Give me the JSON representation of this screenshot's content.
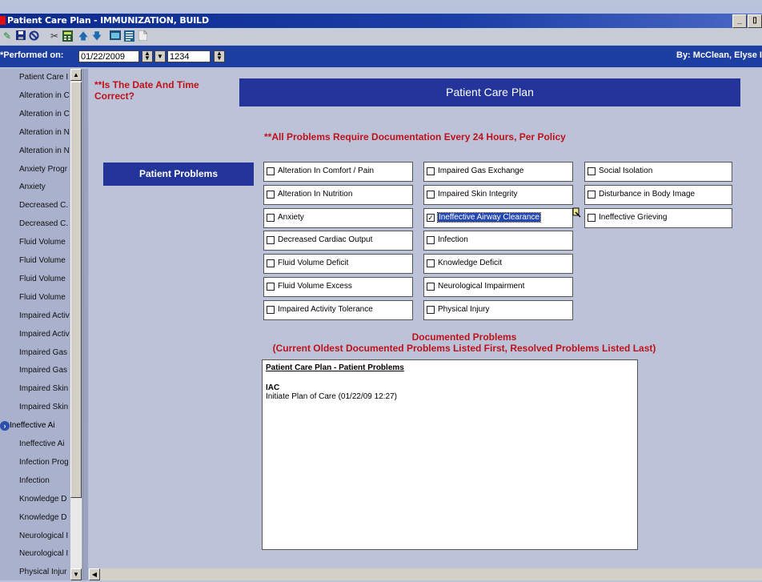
{
  "window": {
    "title": "Patient Care Plan - IMMUNIZATION, BUILD",
    "buttons": [
      "_",
      "▯"
    ]
  },
  "toolbar": {
    "icons": [
      "pencil-icon",
      "save-icon",
      "cancel-icon",
      "scissors-icon",
      "calculator-icon",
      "up-arrow-icon",
      "down-arrow-icon",
      "calendar-icon",
      "form-icon",
      "document-icon"
    ]
  },
  "performed": {
    "label": "*Performed on:",
    "date": "01/22/2009",
    "time": "1234",
    "by": "By:  McClean, Elyse  I"
  },
  "sidebar": {
    "items": [
      "Patient Care I",
      "Alteration in C",
      "Alteration in C",
      "Alteration in N",
      "Alteration in N",
      "Anxiety Progr",
      "Anxiety",
      "Decreased C.",
      "Decreased C.",
      "Fluid Volume",
      "Fluid Volume",
      "Fluid Volume",
      "Fluid Volume",
      "Impaired Activ",
      "Impaired Activ",
      "Impaired Gas",
      "Impaired Gas",
      "Impaired Skin",
      "Impaired Skin",
      "Ineffective Ai",
      "Ineffective Ai",
      "Infection Prog",
      "Infection",
      "Knowledge D",
      "Knowledge D",
      "Neurological I",
      "Neurological I",
      "Physical Injur"
    ],
    "selected_index": 19
  },
  "main": {
    "date_check": "**Is The Date And Time Correct?",
    "banner": "Patient Care Plan",
    "policy": "**All Problems Require Documentation Every 24 Hours, Per Policy",
    "problems_label": "Patient Problems",
    "col1": [
      {
        "label": "Alteration In Comfort / Pain",
        "checked": false
      },
      {
        "label": "Alteration In Nutrition",
        "checked": false
      },
      {
        "label": "Anxiety",
        "checked": false
      },
      {
        "label": "Decreased Cardiac Output",
        "checked": false
      },
      {
        "label": "Fluid Volume Deficit",
        "checked": false
      },
      {
        "label": "Fluid Volume Excess",
        "checked": false
      },
      {
        "label": "Impaired Activity Tolerance",
        "checked": false
      }
    ],
    "col2": [
      {
        "label": "Impaired Gas Exchange",
        "checked": false
      },
      {
        "label": "Impaired Skin Integrity",
        "checked": false
      },
      {
        "label": "Ineffective Airway Clearance",
        "checked": true
      },
      {
        "label": "Infection",
        "checked": false
      },
      {
        "label": "Knowledge Deficit",
        "checked": false
      },
      {
        "label": "Neurological Impairment",
        "checked": false
      },
      {
        "label": "Physical Injury",
        "checked": false
      }
    ],
    "col3": [
      {
        "label": "Social Isolation",
        "checked": false
      },
      {
        "label": "Disturbance in Body Image",
        "checked": false
      },
      {
        "label": "Ineffective Grieving",
        "checked": false
      }
    ],
    "documented_title": "Documented Problems",
    "documented_sub": "(Current Oldest Documented Problems Listed First, Resolved Problems Listed Last)",
    "doc": {
      "heading": "Patient Care Plan - Patient Problems",
      "section": "IAC",
      "line": "Initiate Plan of Care (01/22/09 12:27)"
    }
  }
}
